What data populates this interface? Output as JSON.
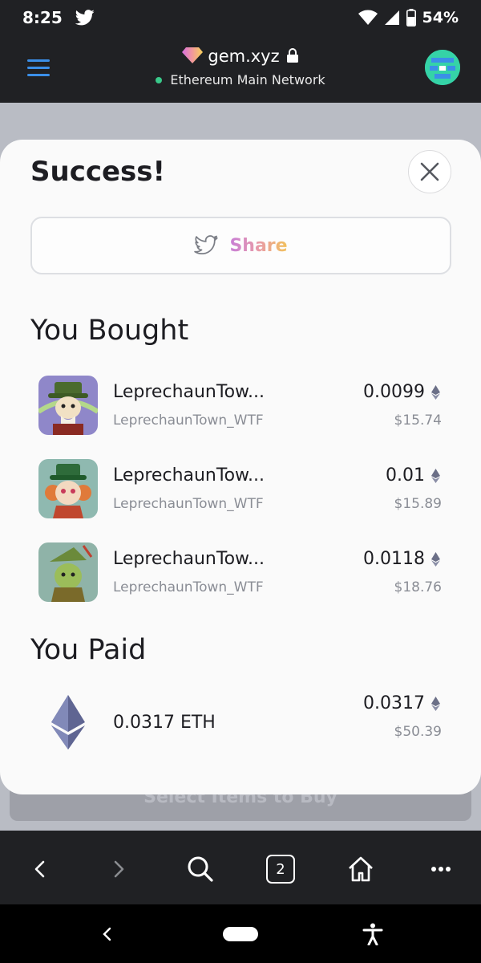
{
  "status_bar": {
    "time": "8:25",
    "battery": "54%"
  },
  "browser": {
    "site": "gem.xyz",
    "network": "Ethereum Main Network",
    "tab_count": "2"
  },
  "modal": {
    "title": "Success!",
    "share_label": "Share",
    "bought_title": "You Bought",
    "paid_title": "You Paid",
    "items": [
      {
        "name": "LeprechaunTow...",
        "collection": "LeprechaunTown_WTF",
        "price": "0.0099",
        "usd": "$15.74"
      },
      {
        "name": "LeprechaunTow...",
        "collection": "LeprechaunTown_WTF",
        "price": "0.01",
        "usd": "$15.89"
      },
      {
        "name": "LeprechaunTow...",
        "collection": "LeprechaunTown_WTF",
        "price": "0.0118",
        "usd": "$18.76"
      }
    ],
    "paid": {
      "amount": "0.0317 ETH",
      "price": "0.0317",
      "usd": "$50.39"
    }
  },
  "background": {
    "button_label": "Select Items to Buy"
  },
  "colors": {
    "header_bg": "#202124",
    "menu_blue": "#3b8fe8",
    "network_dot": "#39c98a",
    "modal_bg": "#fafafa"
  }
}
